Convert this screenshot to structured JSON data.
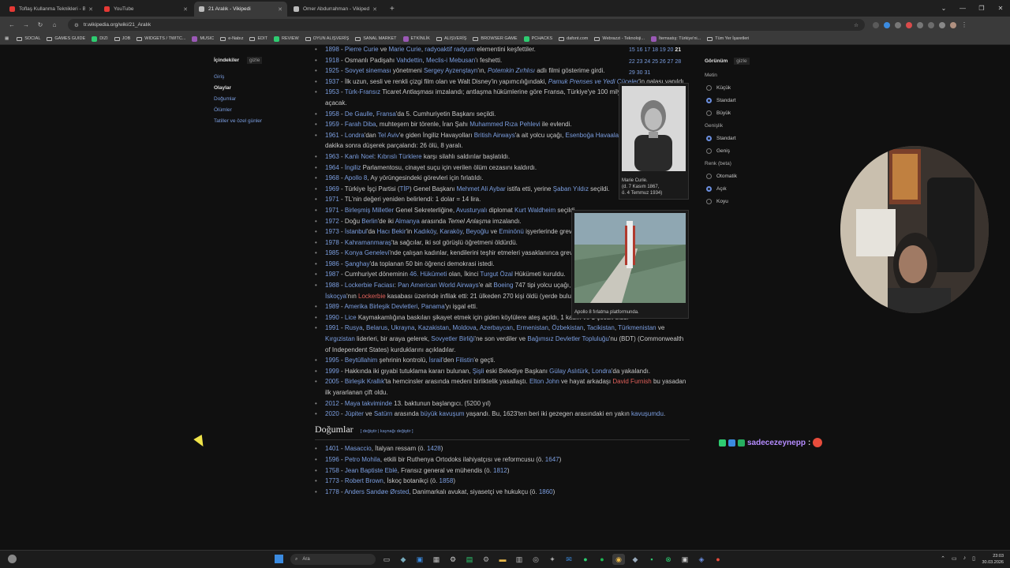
{
  "tabs": [
    {
      "title": "Toflaş Kullanma Teknikleri - Bu…",
      "fav": "#e53935"
    },
    {
      "title": "YouTube",
      "fav": "#e53935"
    },
    {
      "title": "21 Aralık - Vikipedi",
      "fav": "#bbbbbb",
      "active": true
    },
    {
      "title": "Ömer Abdurrahman - Vikipedi",
      "fav": "#bbbbbb"
    }
  ],
  "address": {
    "url": "tr.wikipedia.org/wiki/21_Aralık"
  },
  "bookmarks": [
    "SOCIAL",
    "GAMES GUIDE",
    "DIZI",
    "JOB",
    "WIDGETS / TWITC...",
    "MUSIC",
    "e-Nabız",
    "EDIT",
    "REVIEW",
    "OYUN ALIŞVERİŞ",
    "SANAL MARKET",
    "ETKİNLİK",
    "ALIŞVERİŞ",
    "BROWSER GAME",
    "PCHACKS",
    "dafont.com",
    "Webrazzi - Teknoloji...",
    "İtemsatış: Türkiye'ni...",
    "Tüm Yer İşaretleri"
  ],
  "toc": {
    "title": "İçindekiler",
    "hide": "gizle",
    "items": [
      "Giriş",
      "Olaylar",
      "Doğumlar",
      "Ölümler",
      "Tatiller ve özel günler"
    ]
  },
  "events": [
    [
      {
        "y": "1898"
      },
      {
        "t": " - "
      },
      {
        "l": "Pierre Curie"
      },
      {
        "t": " ve "
      },
      {
        "l": "Marie Curie"
      },
      {
        "t": ", "
      },
      {
        "l": "radyoaktif radyum"
      },
      {
        "t": " elementini keşfettiler."
      }
    ],
    [
      {
        "y": "1918"
      },
      {
        "t": " - Osmanlı Padişahı "
      },
      {
        "l": "Vahdettin"
      },
      {
        "t": ", "
      },
      {
        "l": "Meclis-i Mebusan"
      },
      {
        "t": "'ı feshetti."
      }
    ],
    [
      {
        "y": "1925"
      },
      {
        "t": " - "
      },
      {
        "l": "Sovyet sineması"
      },
      {
        "t": " yönetmeni "
      },
      {
        "l": "Sergey Ayzenştayn"
      },
      {
        "t": "'ın, "
      },
      {
        "li": "Potemkin Zırhlısı"
      },
      {
        "t": " adlı filmi gösterime girdi."
      }
    ],
    [
      {
        "y": "1937"
      },
      {
        "t": " - İlk uzun, sesli ve renkli çizgi film olan ve Walt Disney'in yapımcılığındaki, "
      },
      {
        "li": "Pamuk Prenses ve Yedi Cüceler"
      },
      {
        "t": "'in galası yapıldı."
      }
    ],
    [
      {
        "y": "1953"
      },
      {
        "t": " - "
      },
      {
        "l": "Türk-Fransız"
      },
      {
        "t": " Ticaret Antlaşması imzalandı; antlaşma hükümlerine göre Fransa, Türkiye'ye 100 milyon lira tutarında kredi açacak."
      }
    ],
    [
      {
        "y": "1958"
      },
      {
        "t": " - "
      },
      {
        "l": "De Gaulle"
      },
      {
        "t": ", "
      },
      {
        "l": "Fransa"
      },
      {
        "t": "'da 5. Cumhuriyetin Başkanı seçildi."
      }
    ],
    [
      {
        "y": "1959"
      },
      {
        "t": " - "
      },
      {
        "l": "Farah Diba"
      },
      {
        "t": ", muhteşem bir törenle, İran Şahı "
      },
      {
        "l": "Muhammed Rıza Pehlevi"
      },
      {
        "t": " ile evlendi."
      }
    ],
    [
      {
        "y": "1961"
      },
      {
        "t": " - "
      },
      {
        "l": "Londra"
      },
      {
        "t": "'dan "
      },
      {
        "l": "Tel Aviv"
      },
      {
        "t": "'e giden İngiliz Havayolları "
      },
      {
        "l": "British Airways"
      },
      {
        "t": "'a ait yolcu uçağı, "
      },
      {
        "l": "Esenboğa Havaalanı"
      },
      {
        "t": "'ndan ayrılışından bir dakika sonra düşerek parçalandı: 26 ölü, 8 yaralı."
      }
    ],
    [
      {
        "y": "1963"
      },
      {
        "t": " - "
      },
      {
        "l": "Kanlı Noel"
      },
      {
        "t": ": "
      },
      {
        "l": "Kıbrıslı Türklere"
      },
      {
        "t": " karşı silahlı saldırılar başlatıldı."
      }
    ],
    [
      {
        "y": "1964"
      },
      {
        "t": " - "
      },
      {
        "l": "İngiliz"
      },
      {
        "t": " Parlamentosu, cinayet suçu için verilen ölüm cezasını kaldırdı."
      }
    ],
    [
      {
        "y": "1968"
      },
      {
        "t": " - "
      },
      {
        "l": "Apollo 8"
      },
      {
        "t": ", Ay yörüngesindeki görevleri için fırlatıldı."
      }
    ],
    [
      {
        "y": "1969"
      },
      {
        "t": " - Türkiye İşçi Partisi ("
      },
      {
        "l": "TİP"
      },
      {
        "t": ") Genel Başkanı "
      },
      {
        "l": "Mehmet Ali Aybar"
      },
      {
        "t": " istifa etti, yerine "
      },
      {
        "l": "Şaban Yıldız"
      },
      {
        "t": " seçildi."
      }
    ],
    [
      {
        "y": "1971"
      },
      {
        "t": " - TL'nin değeri yeniden belirlendi: 1 dolar = 14 lira."
      }
    ],
    [
      {
        "y": "1971"
      },
      {
        "t": " - "
      },
      {
        "l": "Birleşmiş Milletler"
      },
      {
        "t": " Genel Sekreterliğine, "
      },
      {
        "l": "Avusturyalı"
      },
      {
        "t": " diplomat "
      },
      {
        "l": "Kurt Waldheim"
      },
      {
        "t": " seçildi."
      }
    ],
    [
      {
        "y": "1972"
      },
      {
        "t": " - Doğu "
      },
      {
        "l": "Berlin"
      },
      {
        "t": "'de iki "
      },
      {
        "l": "Almanya"
      },
      {
        "t": " arasında "
      },
      {
        "i": "Temel Anlaşma"
      },
      {
        "t": " imzalandı."
      }
    ],
    [
      {
        "y": "1973"
      },
      {
        "t": " - "
      },
      {
        "l": "İstanbul"
      },
      {
        "t": "'da "
      },
      {
        "l": "Hacı Bekir"
      },
      {
        "t": "'in "
      },
      {
        "l": "Kadıköy"
      },
      {
        "t": ", "
      },
      {
        "l": "Karaköy"
      },
      {
        "t": ", "
      },
      {
        "l": "Beyoğlu"
      },
      {
        "t": " ve "
      },
      {
        "l": "Eminönü"
      },
      {
        "t": " işyerlerinde grev başladı."
      }
    ],
    [
      {
        "y": "1978"
      },
      {
        "t": " - "
      },
      {
        "l": "Kahramanmaraş"
      },
      {
        "t": "'ta sağcılar, iki sol görüşlü öğretmeni öldürdü."
      }
    ],
    [
      {
        "y": "1985"
      },
      {
        "t": " - "
      },
      {
        "l": "Konya Genelevi"
      },
      {
        "t": "'nde çalışan kadınlar, kendilerini teşhir etmeleri yasaklanınca greve gittiler."
      }
    ],
    [
      {
        "y": "1986"
      },
      {
        "t": " - "
      },
      {
        "l": "Şanghay"
      },
      {
        "t": "'da toplanan 50 bin öğrenci demokrasi istedi."
      }
    ],
    [
      {
        "y": "1987"
      },
      {
        "t": " - Cumhuriyet döneminin "
      },
      {
        "l": "46. Hükümeti"
      },
      {
        "t": " olan, İkinci "
      },
      {
        "l": "Turgut Özal"
      },
      {
        "t": " Hükümeti kuruldu."
      }
    ],
    [
      {
        "y": "1988"
      },
      {
        "t": " - "
      },
      {
        "l": "Lockerbie Faciası"
      },
      {
        "t": ": "
      },
      {
        "l": "Pan American World Airways"
      },
      {
        "t": "'e ait "
      },
      {
        "l": "Boeing"
      },
      {
        "t": " 747 tipi yolcu uçağı, "
      },
      {
        "l": "Londra-New York"
      },
      {
        "t": " seferini yaparken, "
      },
      {
        "l": "İskoçya"
      },
      {
        "t": "'nın "
      },
      {
        "r": "Lockerbie"
      },
      {
        "t": " kasabası üzerinde infilak etti: 21 ülkeden 270 kişi öldü (yerde bulunan 11 kişi dahil)."
      }
    ],
    [
      {
        "y": "1989"
      },
      {
        "t": " - "
      },
      {
        "l": "Amerika Birleşik Devletleri"
      },
      {
        "t": ", "
      },
      {
        "l": "Panama"
      },
      {
        "t": "'yı işgal etti."
      }
    ],
    [
      {
        "y": "1990"
      },
      {
        "t": " - "
      },
      {
        "l": "Lice"
      },
      {
        "t": " Kaymakamlığına baskıları şikayet etmek için giden köylülere ateş açıldı, 1 kadın ve 1 çocuk öldü."
      }
    ],
    [
      {
        "y": "1991"
      },
      {
        "t": " - "
      },
      {
        "l": "Rusya"
      },
      {
        "t": ", "
      },
      {
        "l": "Belarus"
      },
      {
        "t": ", "
      },
      {
        "l": "Ukrayna"
      },
      {
        "t": ", "
      },
      {
        "l": "Kazakistan"
      },
      {
        "t": ", "
      },
      {
        "l": "Moldova"
      },
      {
        "t": ", "
      },
      {
        "l": "Azerbaycan"
      },
      {
        "t": ", "
      },
      {
        "l": "Ermenistan"
      },
      {
        "t": ", "
      },
      {
        "l": "Özbekistan"
      },
      {
        "t": ", "
      },
      {
        "l": "Tacikistan"
      },
      {
        "t": ", "
      },
      {
        "l": "Türkmenistan"
      },
      {
        "t": " ve "
      },
      {
        "l": "Kırgızistan"
      },
      {
        "t": " liderleri, bir araya gelerek, "
      },
      {
        "l": "Sovyetler Birliği"
      },
      {
        "t": "'ne son verdiler ve "
      },
      {
        "l": "Bağımsız Devletler Topluluğu"
      },
      {
        "t": "'nu (BDT) (Commonwealth of Independent States) kurduklarını açıkladılar."
      }
    ],
    [
      {
        "y": "1995"
      },
      {
        "t": " - "
      },
      {
        "l": "Beytüllahim"
      },
      {
        "t": " şehrinin kontrolü, "
      },
      {
        "l": "İsrail"
      },
      {
        "t": "'den "
      },
      {
        "l": "Filistin"
      },
      {
        "t": "'e geçti."
      }
    ],
    [
      {
        "y": "1999"
      },
      {
        "t": " - Hakkında iki gıyabi tutuklama kararı bulunan, "
      },
      {
        "l": "Şişli"
      },
      {
        "t": " eski Belediye Başkanı "
      },
      {
        "l": "Gülay Aslıtürk"
      },
      {
        "t": ", "
      },
      {
        "l": "Londra"
      },
      {
        "t": "'da yakalandı."
      }
    ],
    [
      {
        "y": "2005"
      },
      {
        "t": " - "
      },
      {
        "l": "Birleşik Krallık"
      },
      {
        "t": "'ta hemcinsler arasında medeni birliktelik yasallaştı. "
      },
      {
        "l": "Elton John"
      },
      {
        "t": " ve hayat arkadaşı "
      },
      {
        "r": "David Furnish"
      },
      {
        "t": " bu yasadan ilk yararlanan çift oldu."
      }
    ],
    [
      {
        "y": "2012"
      },
      {
        "t": " - "
      },
      {
        "l": "Maya takviminde"
      },
      {
        "t": " 13. baktunun başlangıcı. (5200 yıl)"
      }
    ],
    [
      {
        "y": "2020"
      },
      {
        "t": " - "
      },
      {
        "l": "Jüpiter"
      },
      {
        "t": " ve "
      },
      {
        "l": "Satürn"
      },
      {
        "t": " arasında "
      },
      {
        "l": "büyük kavuşum"
      },
      {
        "t": " yaşandı. Bu, 1623'ten beri iki gezegen arasındaki en yakın "
      },
      {
        "l": "kavuşumdu"
      },
      {
        "t": "."
      }
    ]
  ],
  "births_heading": "Doğumlar",
  "births_edit": "[ değiştir | kaynağı değiştir ]",
  "births": [
    [
      {
        "y": "1401"
      },
      {
        "t": " - "
      },
      {
        "l": "Masaccio"
      },
      {
        "t": ", İtalyan ressam (ö. "
      },
      {
        "l": "1428"
      },
      {
        "t": ")"
      }
    ],
    [
      {
        "y": "1596"
      },
      {
        "t": " - "
      },
      {
        "l": "Petro Mohila"
      },
      {
        "t": ", etkili bir Ruthenya Ortodoks ilahiyatçısı ve reformcusu (ö. "
      },
      {
        "l": "1647"
      },
      {
        "t": ")"
      }
    ],
    [
      {
        "y": "1758"
      },
      {
        "t": " - "
      },
      {
        "l": "Jean Baptiste Eblé"
      },
      {
        "t": ", Fransız general ve mühendis (ö. "
      },
      {
        "l": "1812"
      },
      {
        "t": ")"
      }
    ],
    [
      {
        "y": "1773"
      },
      {
        "t": " - "
      },
      {
        "l": "Robert Brown"
      },
      {
        "t": ", İskoç botanikçi (ö. "
      },
      {
        "l": "1858"
      },
      {
        "t": ")"
      }
    ],
    [
      {
        "y": "1778"
      },
      {
        "t": " - "
      },
      {
        "l": "Anders Sandøe Ørsted"
      },
      {
        "t": ", Danimarkalı avukat, siyasetçi ve hukukçu (ö. "
      },
      {
        "l": "1860"
      },
      {
        "t": ")"
      }
    ]
  ],
  "thumb1": {
    "caption": "Marie Curie.\n(d. 7 Kasım 1867,\nö. 4 Temmuz 1934)"
  },
  "thumb2": {
    "caption": "Apollo 8 fırlatma platformunda."
  },
  "calendar": {
    "row1": "15 16 17 18 19 20",
    "today": "21",
    "row2": "22 23 24 25 26 27 28",
    "row3": "29 30 31"
  },
  "appearance": {
    "title": "Görünüm",
    "hide": "gizle",
    "text_label": "Metin",
    "text_opts": [
      "Küçük",
      "Standart",
      "Büyük"
    ],
    "width_label": "Genişlik",
    "width_opts": [
      "Standart",
      "Geniş"
    ],
    "color_label": "Renk (beta)",
    "color_opts": [
      "Otomatik",
      "Açık",
      "Koyu"
    ]
  },
  "chat": {
    "user": "sadecezeynepp",
    "sep": ":"
  },
  "taskbar": {
    "search": "Ara",
    "time": "23:03",
    "date": "30.03.2026"
  }
}
